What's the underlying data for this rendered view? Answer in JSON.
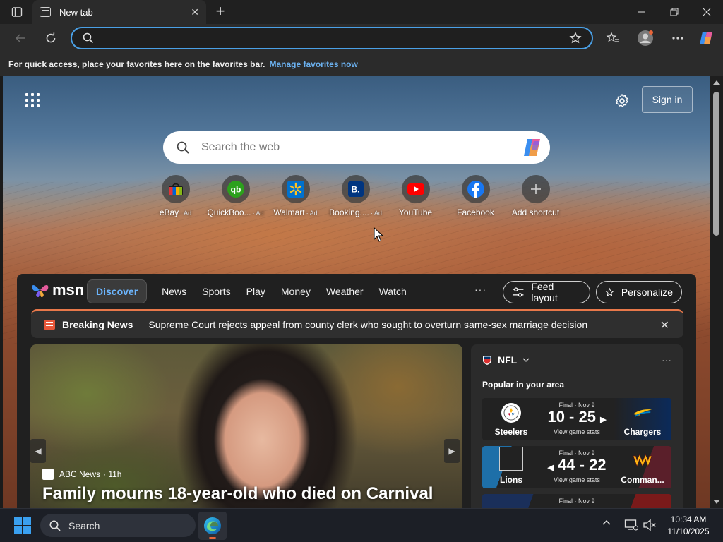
{
  "browser": {
    "tab": {
      "title": "New tab"
    },
    "address": {
      "value": "",
      "placeholder": ""
    },
    "favorites_bar": {
      "message": "For quick access, place your favorites here on the favorites bar.",
      "link": "Manage favorites now"
    }
  },
  "ntp": {
    "sign_in": "Sign in",
    "search": {
      "placeholder": "Search the web"
    },
    "shortcuts": [
      {
        "label": "eBay",
        "ad": "· Ad",
        "icon": "ebay-icon"
      },
      {
        "label": "QuickBoo...",
        "ad": "· Ad",
        "icon": "quickbooks-icon"
      },
      {
        "label": "Walmart",
        "ad": "· Ad",
        "icon": "walmart-icon"
      },
      {
        "label": "Booking....",
        "ad": "· Ad",
        "icon": "booking-icon"
      },
      {
        "label": "YouTube",
        "ad": "",
        "icon": "youtube-icon"
      },
      {
        "label": "Facebook",
        "ad": "",
        "icon": "facebook-icon"
      },
      {
        "label": "Add shortcut",
        "ad": "",
        "icon": "plus-icon"
      }
    ]
  },
  "feed": {
    "logo": "msn",
    "nav": [
      "Discover",
      "News",
      "Sports",
      "Play",
      "Money",
      "Weather",
      "Watch"
    ],
    "more": "···",
    "feed_layout": "Feed layout",
    "personalize": "Personalize",
    "breaking": {
      "label": "Breaking News",
      "headline": "Supreme Court rejects appeal from county clerk who sought to overturn same-sex marriage decision"
    },
    "hero": {
      "source": "ABC News",
      "age": "· 11h",
      "title": "Family mourns 18-year-old who died on Carnival"
    },
    "sports": {
      "league": "NFL",
      "more": "···",
      "popular": "Popular in your area",
      "games": [
        {
          "status": "Final · Nov 9",
          "score": "10 - 25",
          "stats": "View game stats",
          "home": "Steelers",
          "away": "Chargers",
          "winner": "away",
          "left_color": "#1c1c1c",
          "right_color": "#0b2a5a"
        },
        {
          "status": "Final · Nov 9",
          "score": "44 - 22",
          "stats": "View game stats",
          "home": "Lions",
          "away": "Comman...",
          "winner": "home",
          "left_color": "#1e6fa8",
          "right_color": "#5a1f2a"
        },
        {
          "status": "Final · Nov 9",
          "score": "",
          "stats": "",
          "home": "",
          "away": "",
          "winner": "",
          "left_color": "#1a2f5a",
          "right_color": "#7a1a1a"
        }
      ]
    }
  },
  "taskbar": {
    "search_placeholder": "Search",
    "time": "10:34 AM",
    "date": "11/10/2025"
  },
  "colors": {
    "accent": "#4aa0e6",
    "discover_active": "#6cb6ff",
    "breaking_accent": "#e8784a",
    "link": "#6bb0ee"
  }
}
